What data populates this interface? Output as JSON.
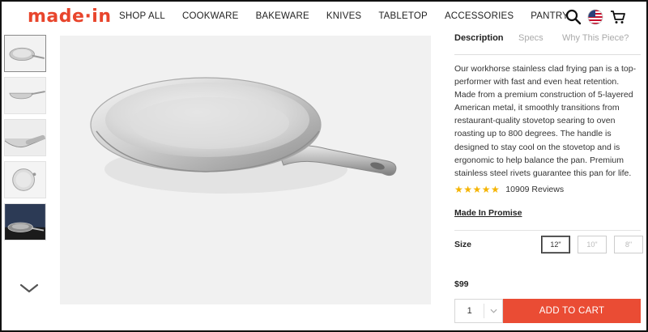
{
  "brand": {
    "logo_text": "made·in",
    "accent_color": "#e8452c"
  },
  "nav": {
    "items": [
      {
        "label": "SHOP ALL"
      },
      {
        "label": "COOKWARE"
      },
      {
        "label": "BAKEWARE"
      },
      {
        "label": "KNIVES"
      },
      {
        "label": "TABLETOP"
      },
      {
        "label": "ACCESSORIES"
      },
      {
        "label": "PANTRY"
      }
    ],
    "icons": [
      "search-icon",
      "us-flag-icon",
      "cart-icon"
    ]
  },
  "gallery": {
    "thumbnails": [
      {
        "view": "pan top view",
        "selected": true
      },
      {
        "view": "pan side view",
        "selected": false
      },
      {
        "view": "pan handle close-up",
        "selected": false
      },
      {
        "view": "pan inside texture",
        "selected": false
      },
      {
        "view": "pan on stovetop",
        "selected": false
      }
    ],
    "scroll_icon": "chevron-down-icon",
    "main_image": "stainless clad frying pan"
  },
  "tabs": [
    {
      "label": "Description",
      "active": true
    },
    {
      "label": "Specs",
      "active": false
    },
    {
      "label": "Why This Piece?",
      "active": false
    }
  ],
  "description": "Our workhorse stainless clad frying pan is a top-performer with fast and even heat retention. Made from a premium construction of 5-layered American metal, it smoothly transitions from restaurant-quality stovetop searing to oven roasting up to 800 degrees. The handle is designed to stay cool on the stovetop and is ergonomic to help balance the pan. Premium stainless steel rivets guarantee this pan for life.",
  "rating": {
    "stars": "★★★★★",
    "star_count": 5,
    "reviews_text": "10909 Reviews",
    "star_color": "#f5b400"
  },
  "promise_link": "Made In Promise",
  "size": {
    "label": "Size",
    "options": [
      {
        "label": "12\"",
        "selected": true
      },
      {
        "label": "10\"",
        "selected": false
      },
      {
        "label": "8\"",
        "selected": false
      }
    ]
  },
  "price": "$99",
  "quantity": {
    "value": "1"
  },
  "add_to_cart": {
    "label": "ADD TO CART",
    "color": "#ea4c34"
  }
}
